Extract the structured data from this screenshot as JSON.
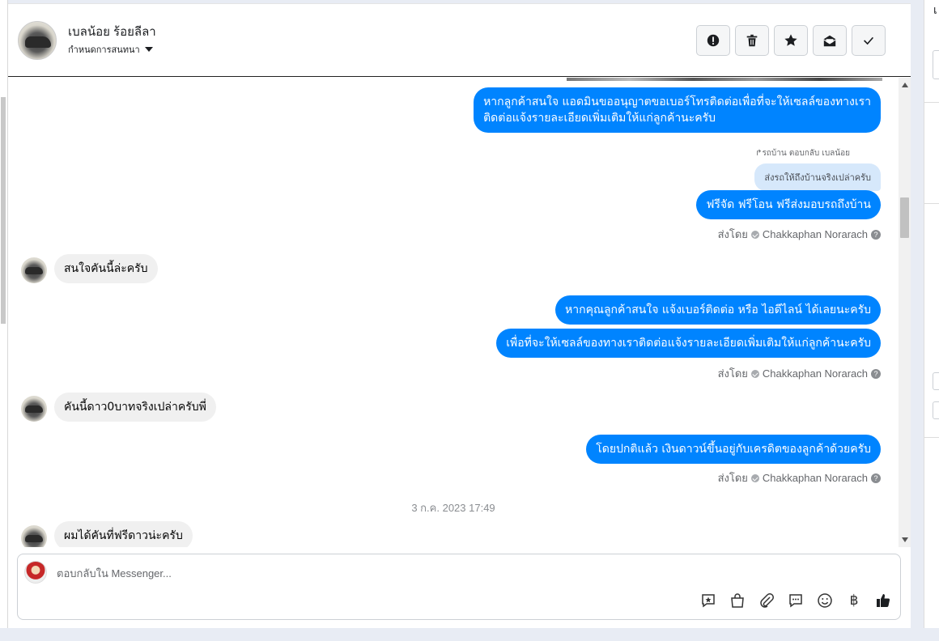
{
  "header": {
    "name": "เบลน้อย ร้อยลีลา",
    "subtitle": "กำหนดการสนทนา",
    "actions": [
      {
        "name": "spam-button",
        "icon": "alert-icon"
      },
      {
        "name": "delete-button",
        "icon": "trash-icon"
      },
      {
        "name": "star-button",
        "icon": "star-icon"
      },
      {
        "name": "mark-unread-button",
        "icon": "envelope-icon"
      },
      {
        "name": "done-button",
        "icon": "check-icon"
      }
    ]
  },
  "messages": {
    "m1_line1": "หากลูกค้าสนใจ แอดมินขออนุญาตขอเบอร์โทรติดต่อเพื่อที่จะให้เซลล์ของทางเรา",
    "m1_line2": "ติดต่อแจ้งรายละเอียดเพิ่มเติมให้แก่ลูกค้านะครับ",
    "reply_note": "รถบ้าน ตอบกลับ เบลน้อย",
    "quoted": "ส่งรถให้ถึงบ้านจริงเปล่าครับ",
    "m2": "ฟรีจัด ฟรีโอน  ฟรีส่งมอบรถถึงบ้าน",
    "sent_by_label": "ส่งโดย",
    "sender": "Chakkaphan Norarach",
    "in1": "สนใจคันนี้ล่ะครับ",
    "m3": "หากคุณลูกค้าสนใจ แจ้งเบอร์ติดต่อ หรือ ไอดีไลน์ ได้เลยนะครับ",
    "m4": "เพื่อที่จะให้เซลล์ของทางเราติดต่อแจ้งรายละเอียดเพิ่มเติมให้แก่ลูกค้านะครับ",
    "in2": "คันนี้ดาว0บาทจริงเปล่าครับพี่",
    "m5": "โดยปกติแล้ว เงินดาวน์ขึ้นอยู่กับเครดิตของลูกค้าด้วยครับ",
    "timestamp": "3 ก.ค. 2023 17:49",
    "in3": "ผมได้คันที่ฟรีดาวน่ะครับ"
  },
  "composer": {
    "placeholder": "ตอบกลับใน Messenger...",
    "tools": [
      "saved-reply-icon",
      "shop-icon",
      "attachment-icon",
      "chat-icon",
      "emoji-icon",
      "baht-icon",
      "like-icon"
    ],
    "baht_glyph": "฿"
  },
  "colors": {
    "outgoing": "#0084ff",
    "incoming": "#f0f0f0",
    "quote": "#d6e8fb"
  }
}
